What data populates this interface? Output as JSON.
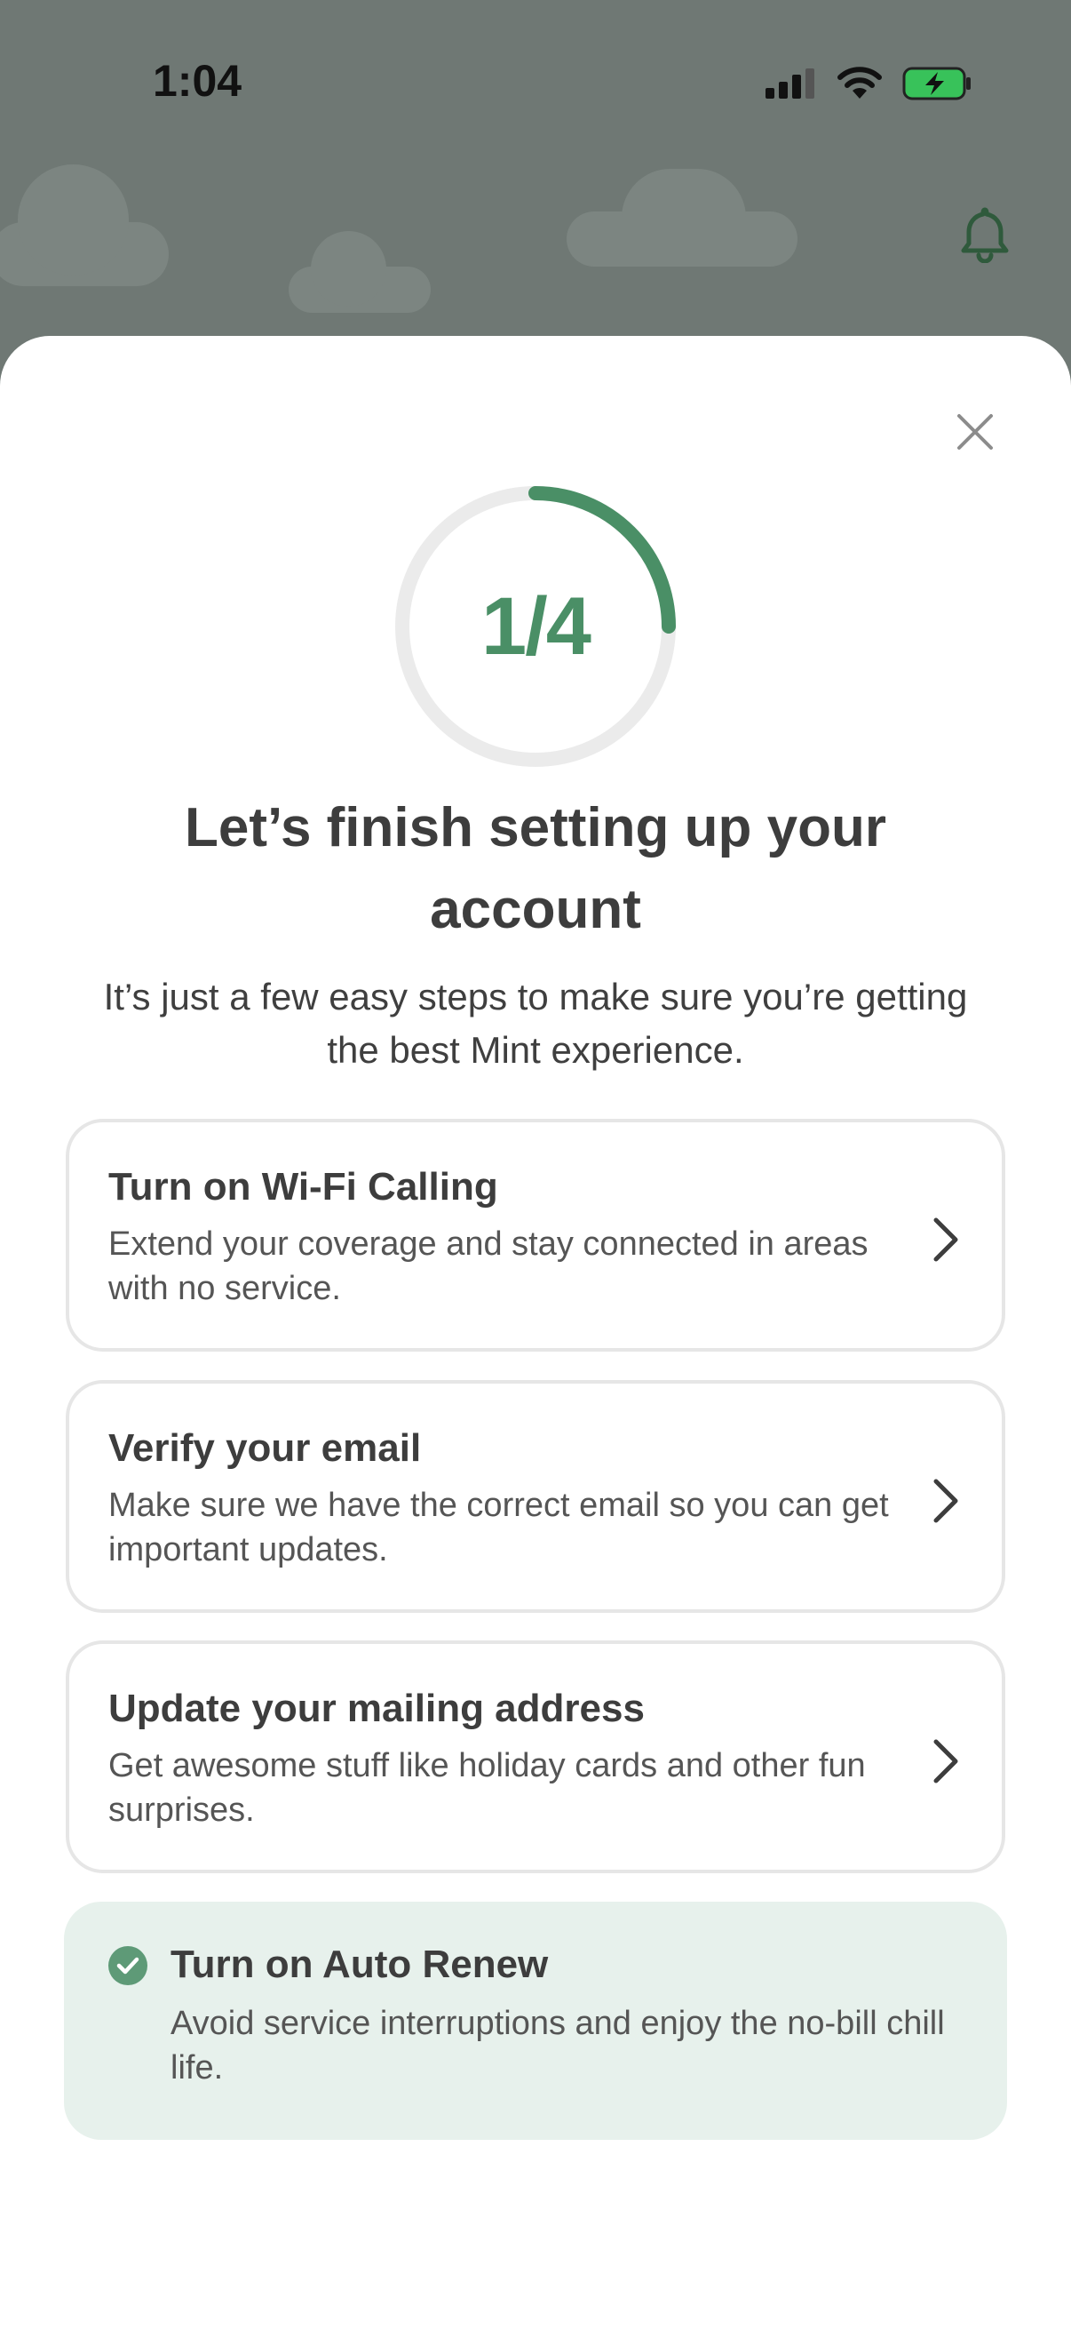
{
  "status_bar": {
    "time": "1:04"
  },
  "progress": {
    "label": "1/4",
    "completed": 1,
    "total": 4,
    "fraction": 0.25,
    "accent": "#4a8f66"
  },
  "header": {
    "title": "Let’s finish setting up your account",
    "subtitle": "It’s just a few easy steps to make sure you’re getting the best Mint experience."
  },
  "tasks": [
    {
      "title": "Turn on Wi-Fi Calling",
      "description": "Extend your coverage and stay connected in areas with no service."
    },
    {
      "title": "Verify your email",
      "description": "Make sure we have the correct email so you can get important updates."
    },
    {
      "title": "Update your mailing address",
      "description": "Get awesome stuff like holiday cards and other fun surprises."
    }
  ],
  "completed_task": {
    "title": "Turn on Auto Renew",
    "description": "Avoid service interruptions and enjoy the no-bill chill life."
  },
  "icons": [
    "signal-icon",
    "wifi-icon",
    "battery-charging-icon",
    "bell-icon",
    "close-icon",
    "chevron-right-icon",
    "check-circle-icon"
  ]
}
